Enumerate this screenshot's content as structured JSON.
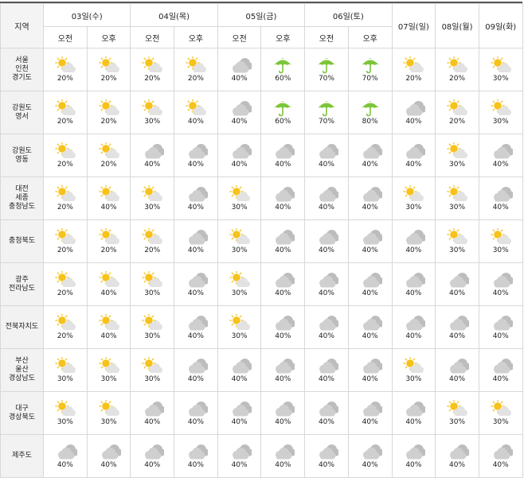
{
  "header": {
    "region_label": "지역",
    "days": [
      {
        "label": "03일(수)",
        "split": true
      },
      {
        "label": "04일(목)",
        "split": true
      },
      {
        "label": "05일(금)",
        "split": true
      },
      {
        "label": "06일(토)",
        "split": true
      },
      {
        "label": "07일(일)",
        "split": false
      },
      {
        "label": "08일(월)",
        "split": false
      },
      {
        "label": "09일(화)",
        "split": false
      }
    ],
    "am_label": "오전",
    "pm_label": "오후"
  },
  "colors": {
    "sun": "#f6c21c",
    "cloud": "#cfcfcf",
    "umbrella": "#7cc63a"
  },
  "rows": [
    {
      "region": [
        "서울",
        "인천",
        "경기도"
      ],
      "cells": [
        {
          "icon": "sun-cloud-icon",
          "pct": "20%"
        },
        {
          "icon": "sun-cloud-icon",
          "pct": "20%"
        },
        {
          "icon": "sun-cloud-icon",
          "pct": "20%"
        },
        {
          "icon": "sun-cloud-icon",
          "pct": "20%"
        },
        {
          "icon": "cloud-icon",
          "pct": "40%"
        },
        {
          "icon": "umbrella-icon",
          "pct": "60%"
        },
        {
          "icon": "umbrella-icon",
          "pct": "70%"
        },
        {
          "icon": "umbrella-icon",
          "pct": "70%"
        },
        {
          "icon": "sun-cloud-icon",
          "pct": "20%"
        },
        {
          "icon": "sun-cloud-icon",
          "pct": "20%"
        },
        {
          "icon": "sun-cloud-icon",
          "pct": "30%"
        }
      ]
    },
    {
      "region": [
        "강원도",
        "영서"
      ],
      "cells": [
        {
          "icon": "sun-cloud-icon",
          "pct": "20%"
        },
        {
          "icon": "sun-cloud-icon",
          "pct": "20%"
        },
        {
          "icon": "sun-cloud-icon",
          "pct": "30%"
        },
        {
          "icon": "sun-cloud-icon",
          "pct": "40%"
        },
        {
          "icon": "cloud-icon",
          "pct": "40%"
        },
        {
          "icon": "umbrella-icon",
          "pct": "60%"
        },
        {
          "icon": "umbrella-icon",
          "pct": "70%"
        },
        {
          "icon": "umbrella-icon",
          "pct": "80%"
        },
        {
          "icon": "cloud-icon",
          "pct": "40%"
        },
        {
          "icon": "sun-cloud-icon",
          "pct": "20%"
        },
        {
          "icon": "sun-cloud-icon",
          "pct": "30%"
        }
      ]
    },
    {
      "region": [
        "강원도",
        "영동"
      ],
      "cells": [
        {
          "icon": "sun-cloud-icon",
          "pct": "20%"
        },
        {
          "icon": "sun-cloud-icon",
          "pct": "20%"
        },
        {
          "icon": "cloud-icon",
          "pct": "40%"
        },
        {
          "icon": "cloud-icon",
          "pct": "40%"
        },
        {
          "icon": "cloud-icon",
          "pct": "40%"
        },
        {
          "icon": "cloud-icon",
          "pct": "40%"
        },
        {
          "icon": "cloud-icon",
          "pct": "40%"
        },
        {
          "icon": "cloud-icon",
          "pct": "40%"
        },
        {
          "icon": "cloud-icon",
          "pct": "40%"
        },
        {
          "icon": "sun-cloud-icon",
          "pct": "30%"
        },
        {
          "icon": "cloud-icon",
          "pct": "40%"
        }
      ]
    },
    {
      "region": [
        "대전",
        "세종",
        "충청남도"
      ],
      "cells": [
        {
          "icon": "sun-cloud-icon",
          "pct": "20%"
        },
        {
          "icon": "sun-cloud-icon",
          "pct": "40%"
        },
        {
          "icon": "sun-cloud-icon",
          "pct": "30%"
        },
        {
          "icon": "cloud-icon",
          "pct": "40%"
        },
        {
          "icon": "sun-cloud-icon",
          "pct": "30%"
        },
        {
          "icon": "cloud-icon",
          "pct": "40%"
        },
        {
          "icon": "cloud-icon",
          "pct": "40%"
        },
        {
          "icon": "cloud-icon",
          "pct": "40%"
        },
        {
          "icon": "sun-cloud-icon",
          "pct": "30%"
        },
        {
          "icon": "sun-cloud-icon",
          "pct": "30%"
        },
        {
          "icon": "cloud-icon",
          "pct": "40%"
        }
      ]
    },
    {
      "region": [
        "충청북도"
      ],
      "cells": [
        {
          "icon": "sun-cloud-icon",
          "pct": "20%"
        },
        {
          "icon": "sun-cloud-icon",
          "pct": "20%"
        },
        {
          "icon": "sun-cloud-icon",
          "pct": "20%"
        },
        {
          "icon": "cloud-icon",
          "pct": "40%"
        },
        {
          "icon": "sun-cloud-icon",
          "pct": "30%"
        },
        {
          "icon": "cloud-icon",
          "pct": "40%"
        },
        {
          "icon": "cloud-icon",
          "pct": "40%"
        },
        {
          "icon": "cloud-icon",
          "pct": "40%"
        },
        {
          "icon": "cloud-icon",
          "pct": "40%"
        },
        {
          "icon": "sun-cloud-icon",
          "pct": "30%"
        },
        {
          "icon": "sun-cloud-icon",
          "pct": "30%"
        }
      ]
    },
    {
      "region": [
        "광주",
        "전라남도"
      ],
      "cells": [
        {
          "icon": "sun-cloud-icon",
          "pct": "20%"
        },
        {
          "icon": "sun-cloud-icon",
          "pct": "40%"
        },
        {
          "icon": "sun-cloud-icon",
          "pct": "30%"
        },
        {
          "icon": "cloud-icon",
          "pct": "40%"
        },
        {
          "icon": "sun-cloud-icon",
          "pct": "30%"
        },
        {
          "icon": "cloud-icon",
          "pct": "40%"
        },
        {
          "icon": "cloud-icon",
          "pct": "40%"
        },
        {
          "icon": "cloud-icon",
          "pct": "40%"
        },
        {
          "icon": "cloud-icon",
          "pct": "40%"
        },
        {
          "icon": "cloud-icon",
          "pct": "40%"
        },
        {
          "icon": "cloud-icon",
          "pct": "40%"
        }
      ]
    },
    {
      "region": [
        "전북자치도"
      ],
      "cells": [
        {
          "icon": "sun-cloud-icon",
          "pct": "20%"
        },
        {
          "icon": "sun-cloud-icon",
          "pct": "40%"
        },
        {
          "icon": "sun-cloud-icon",
          "pct": "30%"
        },
        {
          "icon": "cloud-icon",
          "pct": "40%"
        },
        {
          "icon": "sun-cloud-icon",
          "pct": "30%"
        },
        {
          "icon": "cloud-icon",
          "pct": "40%"
        },
        {
          "icon": "cloud-icon",
          "pct": "40%"
        },
        {
          "icon": "cloud-icon",
          "pct": "40%"
        },
        {
          "icon": "cloud-icon",
          "pct": "40%"
        },
        {
          "icon": "cloud-icon",
          "pct": "40%"
        },
        {
          "icon": "cloud-icon",
          "pct": "40%"
        }
      ]
    },
    {
      "region": [
        "부산",
        "울산",
        "경상남도"
      ],
      "cells": [
        {
          "icon": "sun-cloud-icon",
          "pct": "30%"
        },
        {
          "icon": "sun-cloud-icon",
          "pct": "30%"
        },
        {
          "icon": "sun-cloud-icon",
          "pct": "30%"
        },
        {
          "icon": "cloud-icon",
          "pct": "40%"
        },
        {
          "icon": "cloud-icon",
          "pct": "40%"
        },
        {
          "icon": "cloud-icon",
          "pct": "40%"
        },
        {
          "icon": "cloud-icon",
          "pct": "40%"
        },
        {
          "icon": "cloud-icon",
          "pct": "40%"
        },
        {
          "icon": "sun-cloud-icon",
          "pct": "30%"
        },
        {
          "icon": "cloud-icon",
          "pct": "40%"
        },
        {
          "icon": "cloud-icon",
          "pct": "40%"
        }
      ]
    },
    {
      "region": [
        "대구",
        "경상북도"
      ],
      "cells": [
        {
          "icon": "sun-cloud-icon",
          "pct": "30%"
        },
        {
          "icon": "sun-cloud-icon",
          "pct": "30%"
        },
        {
          "icon": "cloud-icon",
          "pct": "40%"
        },
        {
          "icon": "cloud-icon",
          "pct": "40%"
        },
        {
          "icon": "cloud-icon",
          "pct": "40%"
        },
        {
          "icon": "cloud-icon",
          "pct": "40%"
        },
        {
          "icon": "cloud-icon",
          "pct": "40%"
        },
        {
          "icon": "cloud-icon",
          "pct": "40%"
        },
        {
          "icon": "cloud-icon",
          "pct": "40%"
        },
        {
          "icon": "sun-cloud-icon",
          "pct": "30%"
        },
        {
          "icon": "sun-cloud-icon",
          "pct": "30%"
        }
      ]
    },
    {
      "region": [
        "제주도"
      ],
      "cells": [
        {
          "icon": "cloud-icon",
          "pct": "40%"
        },
        {
          "icon": "cloud-icon",
          "pct": "40%"
        },
        {
          "icon": "cloud-icon",
          "pct": "40%"
        },
        {
          "icon": "cloud-icon",
          "pct": "40%"
        },
        {
          "icon": "cloud-icon",
          "pct": "40%"
        },
        {
          "icon": "cloud-icon",
          "pct": "40%"
        },
        {
          "icon": "cloud-icon",
          "pct": "40%"
        },
        {
          "icon": "cloud-icon",
          "pct": "40%"
        },
        {
          "icon": "cloud-icon",
          "pct": "40%"
        },
        {
          "icon": "cloud-icon",
          "pct": "40%"
        },
        {
          "icon": "cloud-icon",
          "pct": "40%"
        }
      ]
    }
  ]
}
